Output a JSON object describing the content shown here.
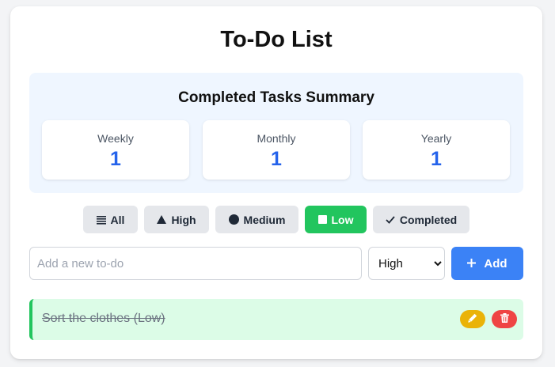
{
  "title": "To-Do List",
  "summary": {
    "title": "Completed Tasks Summary",
    "stats": [
      {
        "label": "Weekly",
        "value": "1"
      },
      {
        "label": "Monthly",
        "value": "1"
      },
      {
        "label": "Yearly",
        "value": "1"
      }
    ]
  },
  "filters": [
    {
      "label": "All",
      "icon": "list-icon"
    },
    {
      "label": "High",
      "icon": "triangle-icon"
    },
    {
      "label": "Medium",
      "icon": "circle-icon"
    },
    {
      "label": "Low",
      "icon": "square-icon",
      "active": true
    },
    {
      "label": "Completed",
      "icon": "check-icon"
    }
  ],
  "form": {
    "placeholder": "Add a new to-do",
    "value": "",
    "priority_selected": "High",
    "add_label": "Add"
  },
  "todos": [
    {
      "text": "Sort the clothes (Low)",
      "completed": true
    }
  ],
  "colors": {
    "accent_green": "#22c55e",
    "accent_blue": "#3b82f6",
    "stat_blue": "#2563eb",
    "edit_yellow": "#eab308",
    "delete_red": "#ef4444"
  }
}
